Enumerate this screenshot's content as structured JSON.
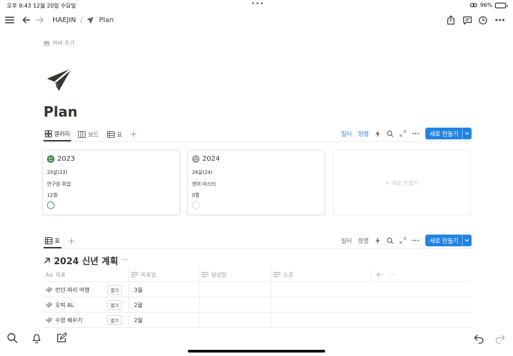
{
  "status": {
    "time_date": "오후 9:43   12월 20일 수요일",
    "dots": "•••",
    "battery_pct": "96%",
    "battery_level": 0.96
  },
  "topbar": {
    "breadcrumb_workspace": "HAEJIN",
    "breadcrumb_sep": "/",
    "breadcrumb_page": "Plan"
  },
  "page": {
    "cover_add": "커버 추가",
    "title": "Plan"
  },
  "gallery_view": {
    "tabs": [
      {
        "label": "갤러리",
        "icon": "gallery-icon",
        "active": true
      },
      {
        "label": "보드",
        "icon": "board-icon",
        "active": false
      },
      {
        "label": "표",
        "icon": "table-icon",
        "active": false
      }
    ],
    "filter": "필터",
    "sort": "정렬",
    "new_button": "새로 만들기"
  },
  "cards": [
    {
      "title": "2023",
      "age": "25살(23)",
      "goal": "연구원 취업",
      "month": "12월",
      "color": "#4a8c5c"
    },
    {
      "title": "2024",
      "age": "26살(24)",
      "goal": "영어 마스터",
      "month": "0월",
      "color": "#a8a49c"
    }
  ],
  "new_card": "+ 새로 만들기",
  "table_view": {
    "tab": "표",
    "filter": "필터",
    "sort": "정렬",
    "new_button": "새로 만들기",
    "title": "2024 신년 계획",
    "title_more": "···",
    "columns": [
      {
        "prefix": "Aa",
        "label": "목표"
      },
      {
        "label": "목표일"
      },
      {
        "label": "달성일"
      },
      {
        "label": "소감"
      }
    ],
    "add_col": "+",
    "col_more": "···",
    "open_label": "열기",
    "rows": [
      {
        "name": "런던-파리 여행",
        "target": "3월"
      },
      {
        "name": "오픽 AL",
        "target": "2월"
      },
      {
        "name": "수영 배우기",
        "target": "2월"
      }
    ]
  }
}
